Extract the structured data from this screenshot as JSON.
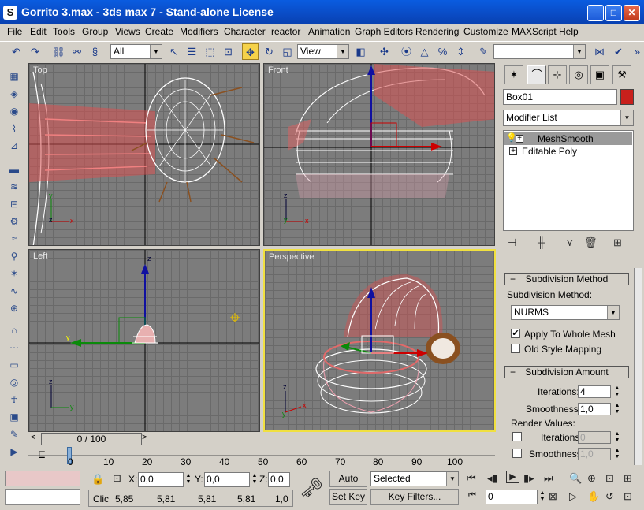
{
  "window": {
    "title": "Gorrito 3.max - 3ds max 7  - Stand-alone License",
    "minimize": "_",
    "maximize": "□",
    "close": "✕"
  },
  "menu": [
    "File",
    "Edit",
    "Tools",
    "Group",
    "Views",
    "Create",
    "Modifiers",
    "Character",
    "reactor",
    "Animation",
    "Graph Editors",
    "Rendering",
    "Customize",
    "MAXScript",
    "Help"
  ],
  "toolbar": {
    "selection_filter": "All",
    "reference_coord": "View",
    "named_selection": ""
  },
  "viewports": {
    "top": "Top",
    "front": "Front",
    "left": "Left",
    "perspective": "Perspective",
    "axis_x": "x",
    "axis_y": "y",
    "axis_z": "z"
  },
  "command_panel": {
    "object_name": "Box01",
    "object_color": "#c8201c",
    "modifier_list": "Modifier List",
    "stack": [
      "MeshSmooth",
      "Editable Poly"
    ],
    "subdivision_method": {
      "header": "Subdivision Method",
      "label": "Subdivision Method:",
      "method": "NURMS",
      "apply_whole_mesh": "Apply To Whole Mesh",
      "apply_whole_mesh_checked": true,
      "old_style": "Old Style Mapping",
      "old_style_checked": false
    },
    "subdivision_amount": {
      "header": "Subdivision Amount",
      "iterations_label": "Iterations:",
      "iterations": "4",
      "smoothness_label": "Smoothness:",
      "smoothness": "1,0",
      "render_values": "Render Values:",
      "render_iterations_label": "Iterations:",
      "render_iterations": "0",
      "render_smoothness_label": "Smoothness:",
      "render_smoothness": "1,0"
    }
  },
  "timeline": {
    "frame_display": "0 / 100",
    "ticks": [
      "0",
      "10",
      "20",
      "30",
      "40",
      "50",
      "60",
      "70",
      "80",
      "90",
      "100"
    ]
  },
  "status": {
    "x_label": "X:",
    "x_value": "0,0",
    "y_label": "Y:",
    "y_value": "0,0",
    "z_label": "Z:",
    "z_value": "0,0",
    "prompt": "Clic",
    "values": [
      "5,85",
      "5,81",
      "5,81",
      "5,81",
      "1,0"
    ],
    "auto_key": "Auto Key",
    "set_key": "Set Key",
    "key_mode": "Selected",
    "key_filters": "Key Filters...",
    "current_frame": "0"
  }
}
